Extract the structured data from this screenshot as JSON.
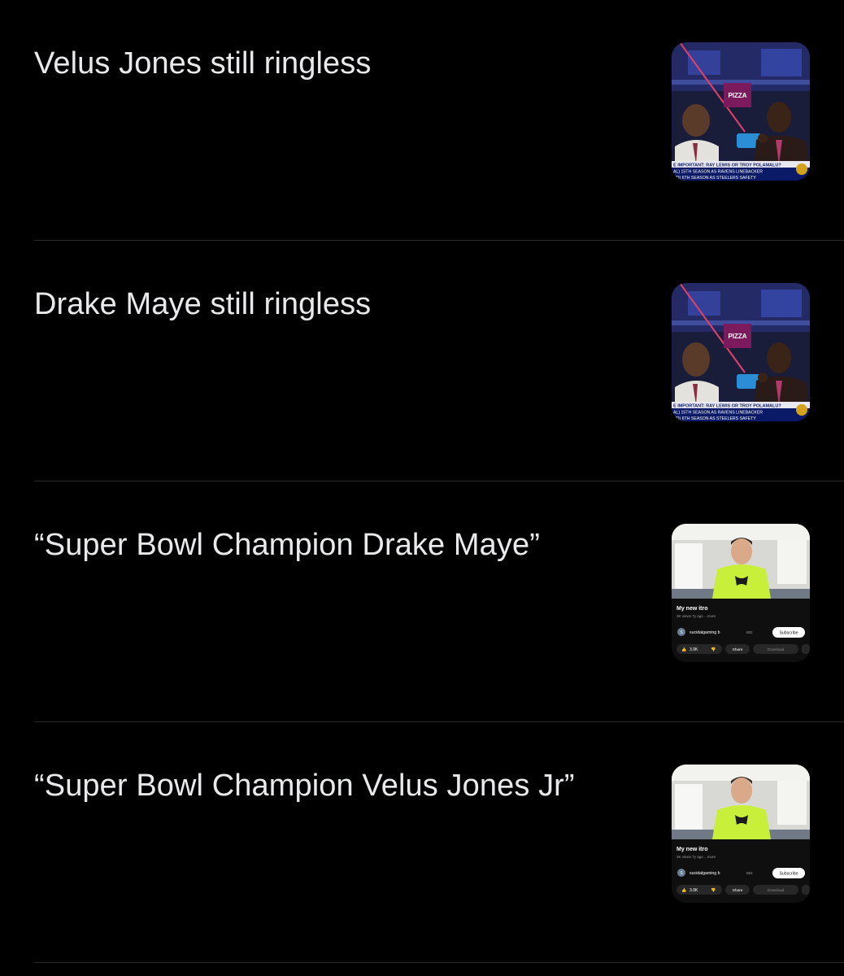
{
  "posts": [
    {
      "text": "Velus Jones still ringless",
      "thumbnail": {
        "kind": "sports-broadcast",
        "ticker_line1": "E IMPORTANT:  RAY LEWIS OR TROY POLAMALU?",
        "ticker_line2": "AL)  15TH SEASON AS RAVENS LINEBACKER",
        "ticker_line3": "ND)  6TH SEASON AS STEELERS SAFETY",
        "sign": "PIZZA"
      }
    },
    {
      "text": "Drake Maye still ringless",
      "thumbnail": {
        "kind": "sports-broadcast",
        "ticker_line1": "E IMPORTANT:  RAY LEWIS OR TROY POLAMALU?",
        "ticker_line2": "AL)  15TH SEASON AS RAVENS LINEBACKER",
        "ticker_line3": "ND)  6TH SEASON AS STEELERS SAFETY",
        "sign": "PIZZA"
      }
    },
    {
      "text": "“Super Bowl Champion Drake Maye”",
      "thumbnail": {
        "kind": "video-screenshot",
        "video_title": "My new itro",
        "meta": "3K views  7y ago  ...more",
        "channel_initial": "S",
        "channel": "sucidalgaming b",
        "subs": "883",
        "subscribe": "Subscribe",
        "likes": "3.9K",
        "share": "Share",
        "download": "Download"
      }
    },
    {
      "text": "“Super Bowl Champion Velus Jones Jr”",
      "thumbnail": {
        "kind": "video-screenshot",
        "video_title": "My new itro",
        "meta": "3K views  7y ago  ...more",
        "channel_initial": "S",
        "channel": "sucidalgaming b",
        "subs": "883",
        "subscribe": "Subscribe",
        "likes": "3.9K",
        "share": "Share",
        "download": "Download"
      }
    }
  ],
  "colors": {
    "background": "#000000",
    "text": "#e7e9ea",
    "divider": "#2a2a2a",
    "shirt": "#c8f03a"
  }
}
